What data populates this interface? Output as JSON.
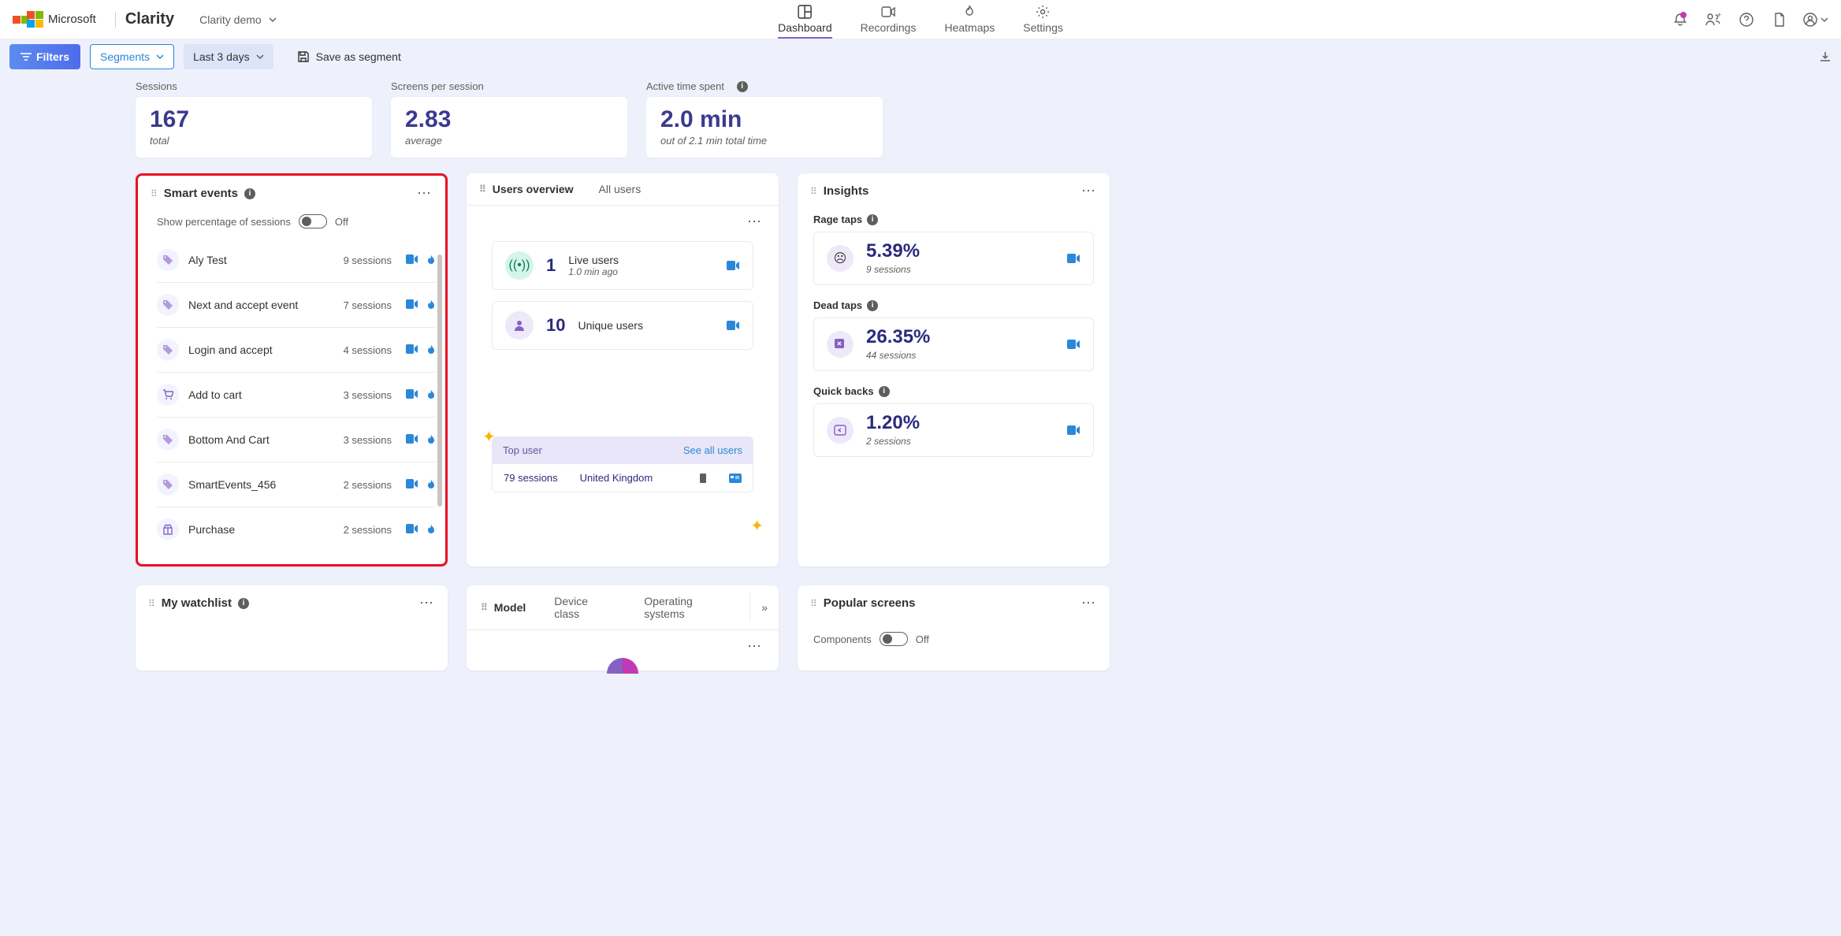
{
  "header": {
    "brand": "Microsoft",
    "app": "Clarity",
    "project": "Clarity demo",
    "tabs": [
      "Dashboard",
      "Recordings",
      "Heatmaps",
      "Settings"
    ]
  },
  "filterbar": {
    "filters": "Filters",
    "segments": "Segments",
    "days": "Last 3 days",
    "save": "Save as segment"
  },
  "metrics": {
    "sessions": {
      "label": "Sessions",
      "value": "167",
      "sub": "total"
    },
    "screens": {
      "label": "Screens per session",
      "value": "2.83",
      "sub": "average"
    },
    "active": {
      "label": "Active time spent",
      "value": "2.0 min",
      "sub": "out of 2.1 min total time"
    }
  },
  "smart_events": {
    "title": "Smart events",
    "toggle_label": "Show percentage of sessions",
    "toggle_state": "Off",
    "items": [
      {
        "name": "Aly Test",
        "sessions": "9 sessions",
        "icon": "tag"
      },
      {
        "name": "Next and accept event",
        "sessions": "7 sessions",
        "icon": "tag"
      },
      {
        "name": "Login and accept",
        "sessions": "4 sessions",
        "icon": "tag"
      },
      {
        "name": "Add to cart",
        "sessions": "3 sessions",
        "icon": "cart"
      },
      {
        "name": "Bottom And Cart",
        "sessions": "3 sessions",
        "icon": "tag"
      },
      {
        "name": "SmartEvents_456",
        "sessions": "2 sessions",
        "icon": "tag"
      },
      {
        "name": "Purchase",
        "sessions": "2 sessions",
        "icon": "gift"
      }
    ]
  },
  "users": {
    "tab1": "Users overview",
    "tab2": "All users",
    "live": {
      "count": "1",
      "label": "Live users",
      "sub": "1.0 min ago"
    },
    "unique": {
      "count": "10",
      "label": "Unique users"
    },
    "top_user_label": "Top user",
    "see_all": "See all users",
    "top_sessions": "79 sessions",
    "top_country": "United Kingdom"
  },
  "insights": {
    "title": "Insights",
    "rage": {
      "label": "Rage taps",
      "pct": "5.39%",
      "sub": "9 sessions"
    },
    "dead": {
      "label": "Dead taps",
      "pct": "26.35%",
      "sub": "44 sessions"
    },
    "quick": {
      "label": "Quick backs",
      "pct": "1.20%",
      "sub": "2 sessions"
    }
  },
  "watchlist": {
    "title": "My watchlist"
  },
  "model": {
    "tabs": [
      "Model",
      "Device class",
      "Operating systems"
    ]
  },
  "popular": {
    "title": "Popular screens",
    "components": "Components",
    "state": "Off"
  }
}
